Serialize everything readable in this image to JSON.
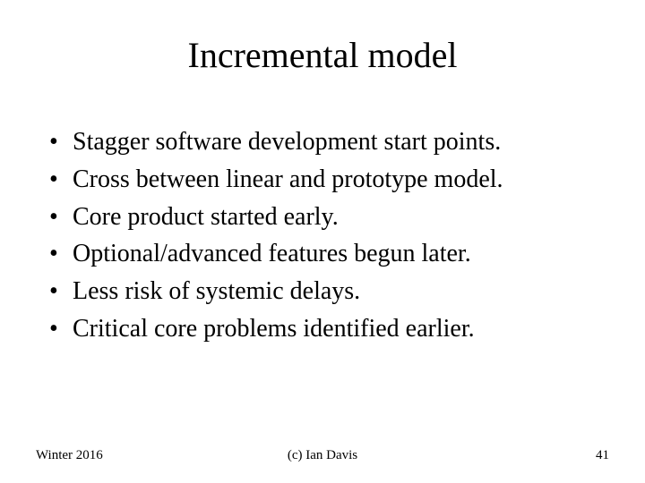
{
  "title": "Incremental model",
  "bullets": [
    "Stagger software development start points.",
    "Cross between linear and prototype model.",
    "Core product started early.",
    "Optional/advanced features begun later.",
    "Less risk of systemic delays.",
    "Critical core problems identified earlier."
  ],
  "footer": {
    "left": "Winter 2016",
    "center": "(c) Ian Davis",
    "right": "41"
  }
}
